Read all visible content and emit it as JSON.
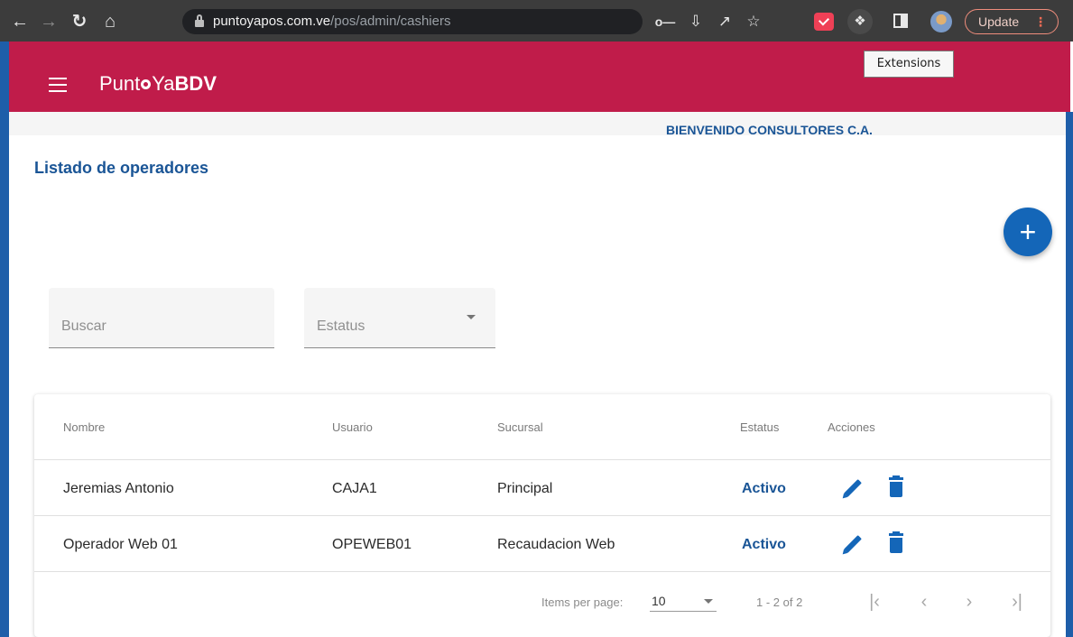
{
  "browser": {
    "url_domain": "puntoyapos.com.ve",
    "url_path": "/pos/admin/cashiers",
    "update_label": "Update",
    "tooltip": "Extensions"
  },
  "app": {
    "logo_part1": "Punt",
    "logo_part2": "Ya",
    "logo_bold": "BDV",
    "welcome": "BIENVENIDO CONSULTORES C.A.",
    "page_title": "Listado de operadores",
    "brand_color": "#c01c4a",
    "accent_color": "#1466b8"
  },
  "filters": {
    "search_placeholder": "Buscar",
    "status_placeholder": "Estatus"
  },
  "table": {
    "columns": [
      "Nombre",
      "Usuario",
      "Sucursal",
      "Estatus",
      "Acciones"
    ],
    "rows": [
      {
        "nombre": "Jeremias Antonio",
        "usuario": "CAJA1",
        "sucursal": "Principal",
        "estatus": "Activo"
      },
      {
        "nombre": "Operador Web 01",
        "usuario": "OPEWEB01",
        "sucursal": "Recaudacion Web",
        "estatus": "Activo"
      }
    ]
  },
  "pagination": {
    "items_per_page_label": "Items per page:",
    "page_size": "10",
    "range": "1 - 2 of 2"
  }
}
